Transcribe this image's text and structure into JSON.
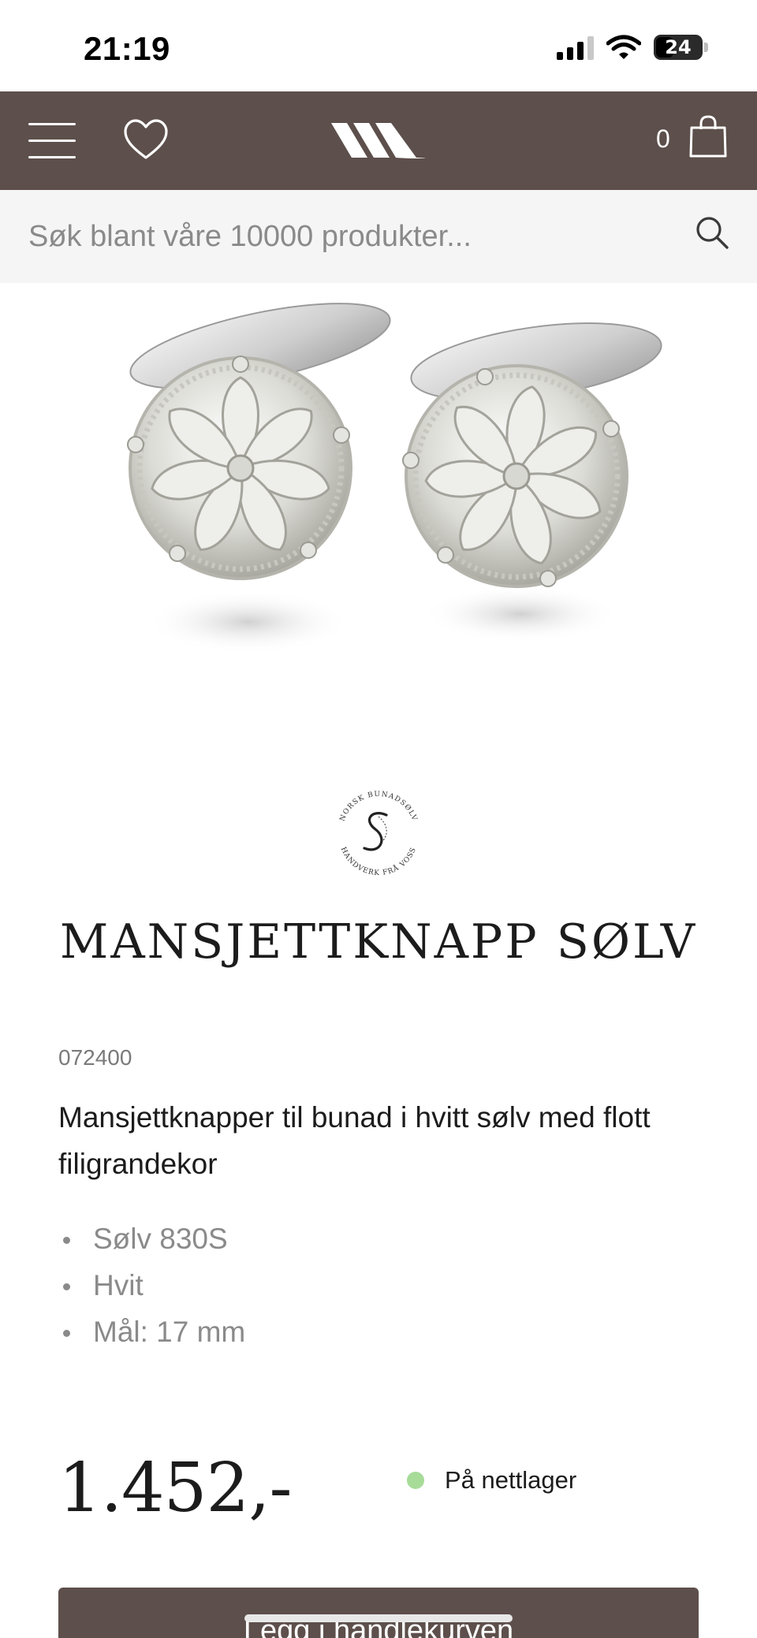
{
  "status_bar": {
    "time": "21:19",
    "battery": "24"
  },
  "header": {
    "cart_count": "0",
    "background_color": "#5d4f4b"
  },
  "search": {
    "placeholder": "Søk blant våre 10000 produkter..."
  },
  "brand_seal": {
    "lettering_top": "NORSK BUNADSØLV",
    "lettering_bottom": "HANDVERK FRÅ VOSS"
  },
  "product": {
    "title": "MANSJETTKNAPP SØLV",
    "sku": "072400",
    "description": "Mansjettknapper til bunad i hvitt sølv med flott filigrandekor",
    "features": [
      "Sølv 830S",
      "Hvit",
      "Mål: 17 mm"
    ],
    "price": "1.452,-",
    "stock_status": "På nettlager",
    "stock_color": "#a6dc98"
  },
  "actions": {
    "add_to_cart_label": "Legg i handlekurven"
  }
}
